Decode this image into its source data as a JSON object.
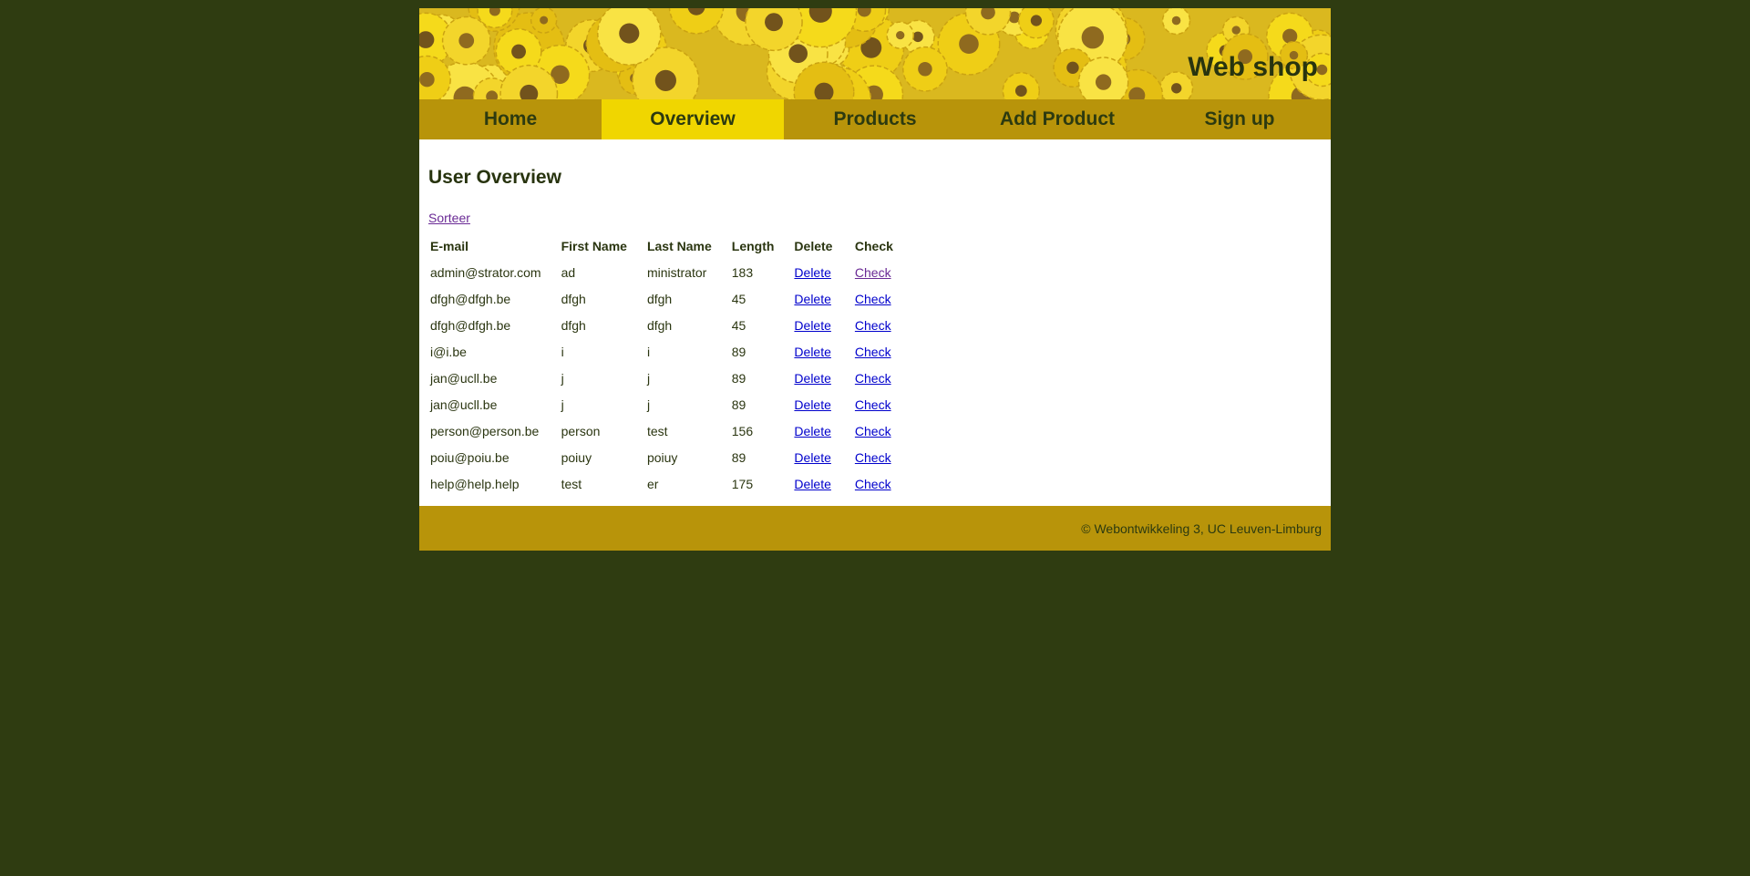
{
  "header": {
    "site_title": "Web shop",
    "banner_image": "sunflower-field"
  },
  "nav": {
    "items": [
      {
        "label": "Home",
        "active": false
      },
      {
        "label": "Overview",
        "active": true
      },
      {
        "label": "Products",
        "active": false
      },
      {
        "label": "Add Product",
        "active": false
      },
      {
        "label": "Sign up",
        "active": false
      }
    ]
  },
  "main": {
    "title": "User Overview",
    "sort_link": "Sorteer",
    "table": {
      "columns": [
        "E-mail",
        "First Name",
        "Last Name",
        "Length",
        "Delete",
        "Check"
      ],
      "rows": [
        {
          "email": "admin@strator.com",
          "first": "ad",
          "last": "ministrator",
          "length": "183",
          "delete": "Delete",
          "check": "Check",
          "check_visited": true
        },
        {
          "email": "dfgh@dfgh.be",
          "first": "dfgh",
          "last": "dfgh",
          "length": "45",
          "delete": "Delete",
          "check": "Check",
          "check_visited": false
        },
        {
          "email": "dfgh@dfgh.be",
          "first": "dfgh",
          "last": "dfgh",
          "length": "45",
          "delete": "Delete",
          "check": "Check",
          "check_visited": false
        },
        {
          "email": "i@i.be",
          "first": "i",
          "last": "i",
          "length": "89",
          "delete": "Delete",
          "check": "Check",
          "check_visited": false
        },
        {
          "email": "jan@ucll.be",
          "first": "j",
          "last": "j",
          "length": "89",
          "delete": "Delete",
          "check": "Check",
          "check_visited": false
        },
        {
          "email": "jan@ucll.be",
          "first": "j",
          "last": "j",
          "length": "89",
          "delete": "Delete",
          "check": "Check",
          "check_visited": false
        },
        {
          "email": "person@person.be",
          "first": "person",
          "last": "test",
          "length": "156",
          "delete": "Delete",
          "check": "Check",
          "check_visited": false
        },
        {
          "email": "poiu@poiu.be",
          "first": "poiuy",
          "last": "poiuy",
          "length": "89",
          "delete": "Delete",
          "check": "Check",
          "check_visited": false
        },
        {
          "email": "help@help.help",
          "first": "test",
          "last": "er",
          "length": "175",
          "delete": "Delete",
          "check": "Check",
          "check_visited": false
        }
      ]
    }
  },
  "footer": {
    "text": "© Webontwikkeling 3, UC Leuven-Limburg"
  },
  "colors": {
    "page_background": "#2f3c11",
    "nav_background": "#b8940a",
    "nav_active": "#f0d600",
    "text_dark": "#2c3a10",
    "link": "#0000cc",
    "link_visited": "#6a2a95"
  }
}
